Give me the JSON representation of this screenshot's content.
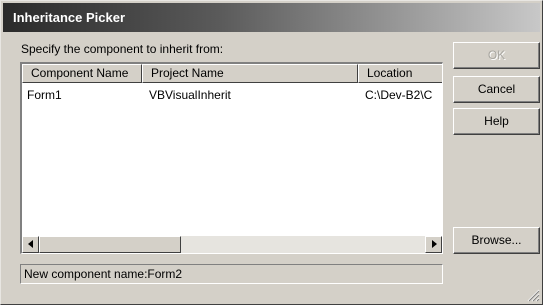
{
  "window": {
    "title": "Inheritance Picker"
  },
  "prompt": "Specify the component to inherit from:",
  "list": {
    "columns": [
      "Component Name",
      "Project Name",
      "Location"
    ],
    "rows": [
      {
        "component": "Form1",
        "project": "VBVisualInherit",
        "location": "C:\\Dev-B2\\C"
      }
    ]
  },
  "status": "New component name:Form2",
  "buttons": {
    "ok": "OK",
    "cancel": "Cancel",
    "help": "Help",
    "browse": "Browse..."
  },
  "icons": {
    "scroll_left": "arrow-left-icon",
    "scroll_right": "arrow-right-icon",
    "resize_grip": "resize-grip-icon"
  }
}
